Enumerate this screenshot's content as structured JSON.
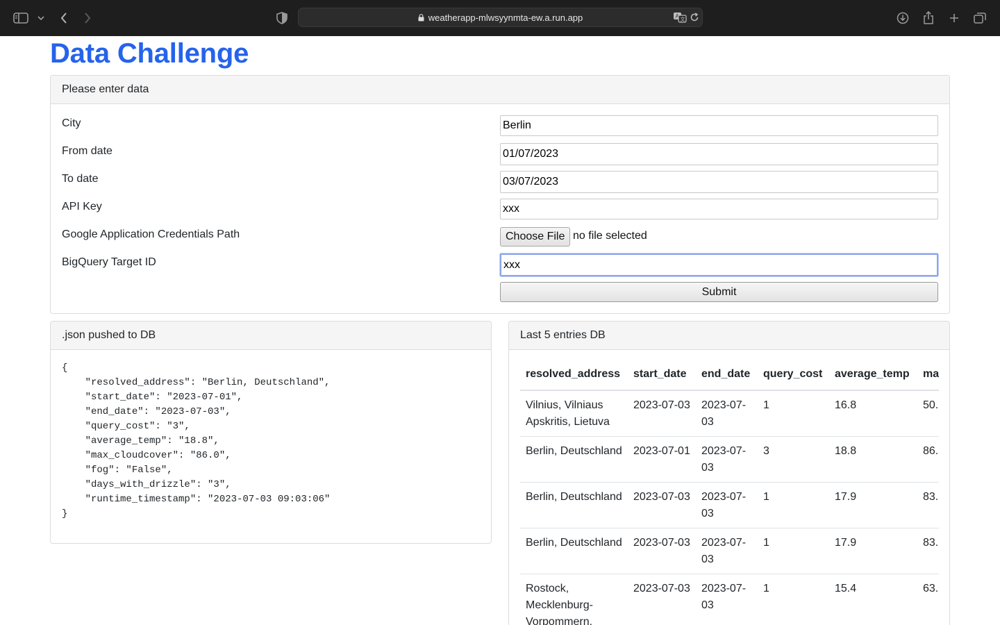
{
  "browser": {
    "url": "weatherapp-mlwsyynmta-ew.a.run.app",
    "icons": [
      "sidebar-icon",
      "chevron-down-icon",
      "back-icon",
      "forward-icon",
      "shield-icon",
      "lock-icon",
      "translate-icon",
      "reload-icon",
      "download-icon",
      "share-icon",
      "new-tab-icon",
      "tabs-overview-icon"
    ]
  },
  "page": {
    "title": "Data Challenge",
    "title_color": "#2563eb"
  },
  "form": {
    "header": "Please enter data",
    "city": {
      "label": "City",
      "value": "Berlin"
    },
    "from_date": {
      "label": "From date",
      "value": "01/07/2023"
    },
    "to_date": {
      "label": "To date",
      "value": "03/07/2023"
    },
    "api_key": {
      "label": "API Key",
      "value": "xxx"
    },
    "credentials": {
      "label": "Google Application Credentials Path",
      "button": "Choose File",
      "status": "no file selected"
    },
    "bigquery": {
      "label": "BigQuery Target ID",
      "value": "xxx"
    },
    "submit": "Submit"
  },
  "json_panel": {
    "header": ".json pushed to DB",
    "content": "{\n    \"resolved_address\": \"Berlin, Deutschland\",\n    \"start_date\": \"2023-07-01\",\n    \"end_date\": \"2023-07-03\",\n    \"query_cost\": \"3\",\n    \"average_temp\": \"18.8\",\n    \"max_cloudcover\": \"86.0\",\n    \"fog\": \"False\",\n    \"days_with_drizzle\": \"3\",\n    \"runtime_timestamp\": \"2023-07-03 09:03:06\"\n}"
  },
  "db_panel": {
    "header": "Last 5 entries DB",
    "columns": [
      "resolved_address",
      "start_date",
      "end_date",
      "query_cost",
      "average_temp",
      "ma"
    ],
    "rows": [
      [
        "Vilnius, Vilniaus Apskritis, Lietuva",
        "2023-07-03",
        "2023-07-03",
        "1",
        "16.8",
        "50."
      ],
      [
        "Berlin, Deutschland",
        "2023-07-01",
        "2023-07-03",
        "3",
        "18.8",
        "86."
      ],
      [
        "Berlin, Deutschland",
        "2023-07-03",
        "2023-07-03",
        "1",
        "17.9",
        "83."
      ],
      [
        "Berlin, Deutschland",
        "2023-07-03",
        "2023-07-03",
        "1",
        "17.9",
        "83."
      ],
      [
        "Rostock, Mecklenburg-Vorpommern,",
        "2023-07-03",
        "2023-07-03",
        "1",
        "15.4",
        "63."
      ]
    ]
  }
}
